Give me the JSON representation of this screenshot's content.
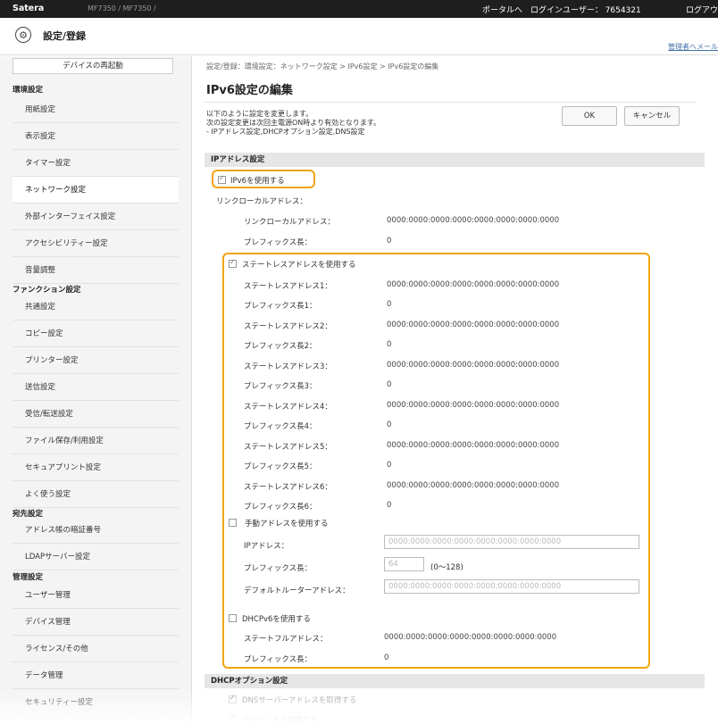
{
  "topbar": {
    "logo": "Satera",
    "device": "MF7350 / MF7350 /",
    "portal": "ポータルへ",
    "login_user": "ログインユーザー： 7654321",
    "logout": "ログアウト"
  },
  "titlebar": {
    "title": "設定/登録",
    "portal_link": "管理者へメール"
  },
  "sidebar": {
    "restart": "デバイスの再起動",
    "group1": "環境設定",
    "items1": [
      "用紙設定",
      "表示設定",
      "タイマー設定",
      "ネットワーク設定",
      "外部インターフェイス設定",
      "アクセシビリティー設定",
      "音量調整"
    ],
    "group2": "ファンクション設定",
    "items2": [
      "共通設定",
      "コピー設定",
      "プリンター設定",
      "送信設定",
      "受信/転送設定",
      "ファイル保存/利用設定",
      "セキュアプリント設定",
      "よく使う設定"
    ],
    "group3": "宛先設定",
    "items3": [
      "アドレス帳の暗証番号",
      "LDAPサーバー設定"
    ],
    "group4": "管理設定",
    "items4": [
      "ユーザー管理",
      "デバイス管理",
      "ライセンス/その他",
      "データ管理",
      "セキュリティー設定"
    ]
  },
  "main": {
    "breadcrumb": "設定/登録：環境設定：ネットワーク設定 > IPv6設定 > IPv6設定の編集",
    "title": "IPv6設定の編集",
    "desc1": "以下のように設定を変更します。",
    "desc2": "次の設定変更は次回主電源ON時より有効となります。",
    "desc3": "- IPアドレス設定,DHCPオプション設定,DNS設定",
    "ok": "OK",
    "cancel": "キャンセル",
    "ip_section": "IPアドレス設定",
    "use_ipv6": "IPv6を使用する",
    "link_local_group": "リンクローカルアドレス：",
    "link_local_addr_label": "リンクローカルアドレス：",
    "link_local_addr": "0000:0000:0000:0000:0000:0000:0000:0000",
    "link_local_prefix_label": "プレフィックス長：",
    "link_local_prefix": "0",
    "use_stateless": "ステートレスアドレスを使用する",
    "stateless": [
      {
        "label": "ステートレスアドレス1：",
        "value": "0000:0000:0000:0000:0000:0000:0000:0000",
        "plabel": "プレフィックス長1：",
        "pvalue": "0"
      },
      {
        "label": "ステートレスアドレス2：",
        "value": "0000:0000:0000:0000:0000:0000:0000:0000",
        "plabel": "プレフィックス長2：",
        "pvalue": "0"
      },
      {
        "label": "ステートレスアドレス3：",
        "value": "0000:0000:0000:0000:0000:0000:0000:0000",
        "plabel": "プレフィックス長3：",
        "pvalue": "0"
      },
      {
        "label": "ステートレスアドレス4：",
        "value": "0000:0000:0000:0000:0000:0000:0000:0000",
        "plabel": "プレフィックス長4：",
        "pvalue": "0"
      },
      {
        "label": "ステートレスアドレス5：",
        "value": "0000:0000:0000:0000:0000:0000:0000:0000",
        "plabel": "プレフィックス長5：",
        "pvalue": "0"
      },
      {
        "label": "ステートレスアドレス6：",
        "value": "0000:0000:0000:0000:0000:0000:0000:0000",
        "plabel": "プレフィックス長6：",
        "pvalue": "0"
      }
    ],
    "use_manual": "手動アドレスを使用する",
    "ip_addr_label": "IPアドレス：",
    "ip_addr_placeholder": "0000:0000:0000:0000:0000:0000:0000:0000",
    "prefix_label": "プレフィックス長：",
    "prefix_value": "64",
    "prefix_range": "(0〜128)",
    "gateway_label": "デフォルトルーターアドレス：",
    "gateway_placeholder": "0000:0000:0000:0000:0000:0000:0000:0000",
    "use_dhcpv6": "DHCPv6を使用する",
    "stateful_label": "ステートフルアドレス：",
    "stateful_value": "0000:0000:0000:0000:0000:0000:0000:0000",
    "stateful_prefix_label": "プレフィックス長：",
    "stateful_prefix": "0",
    "dhcp_section": "DHCPオプション設定",
    "dns_option": "DNSサーバーアドレスを取得する",
    "domain_option": "ドメイン名を取得する"
  },
  "colors": {
    "highlight": "#f3a40f",
    "topbar": "#1e1e1e"
  }
}
